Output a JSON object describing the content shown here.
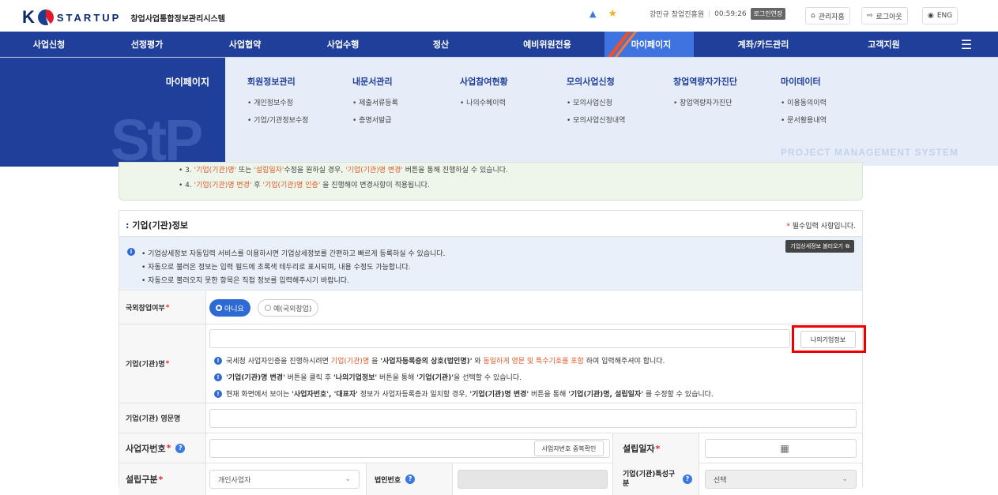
{
  "header": {
    "logo_k": "K",
    "logo_text": "STARTUP",
    "system_name": "창업사업통합정보관리시스템",
    "user_info": "강민규 창업진흥원",
    "timer": "00:59:26",
    "extend_label": "로그인연장",
    "admin_label": "관리자홈",
    "logout_label": "로그아웃",
    "lang_label": "ENG"
  },
  "nav": [
    "사업신청",
    "선정평가",
    "사업협약",
    "사업수행",
    "정산",
    "예비위원전용",
    "마이페이지",
    "계좌/카드관리",
    "고객지원"
  ],
  "mega": {
    "title": "마이페이지",
    "bg_text": "StP",
    "tagline": "PROJECT MANAGEMENT SYSTEM",
    "columns": [
      {
        "title": "회원정보관리",
        "items": [
          "개인정보수정",
          "기업/기관정보수정"
        ]
      },
      {
        "title": "내문서관리",
        "items": [
          "제출서류등록",
          "증명서발급"
        ]
      },
      {
        "title": "사업참여현황",
        "items": [
          "나의수혜이력"
        ]
      },
      {
        "title": "모의사업신청",
        "items": [
          "모의사업신청",
          "모의사업신청내역"
        ]
      },
      {
        "title": "창업역량자가진단",
        "items": [
          "창업역량자가진단"
        ]
      },
      {
        "title": "마이데이터",
        "items": [
          "이용동의이력",
          "문서활용내역"
        ]
      }
    ]
  },
  "notice": {
    "line3_a": "• 3. ",
    "line3_b": "'기업(기관)명'",
    "line3_c": " 또는 ",
    "line3_d": "'설립일자'",
    "line3_e": "수정을 원하실 경우, ",
    "line3_f": "'기업(기관)명 변경'",
    "line3_g": " 버튼을 통해 진행하실 수 있습니다.",
    "line4_a": "• 4. ",
    "line4_b": "'기업(기관)명 변경'",
    "line4_c": " 후 ",
    "line4_d": "'기업(기관)명 인증'",
    "line4_e": " 을 진행해야 변경사항이 적용됩니다."
  },
  "section": {
    "title": "기업(기관)정보",
    "required_note": "필수입력 사항입니다.",
    "load_button": "기업상세정보 불러오기",
    "info_lines": [
      "• 기업상세정보 자동입력 서비스를 이용하시면 기업상세정보를 간편하고 빠르게 등록하실 수 있습니다.",
      "• 자동으로 불러온 정보는 입력 필드에 초록색 테두리로 표시되며, 내용 수정도 가능합니다.",
      "• 자동으로 불러오지 못한 항목은 직접 정보를 입력해주시기 바랍니다."
    ]
  },
  "form": {
    "overseas_label": "국외창업여부",
    "overseas_no": "아니요",
    "overseas_yes": "예(국외창업)",
    "company_label": "기업(기관)명",
    "my_company_button": "나의기업정보",
    "note1_a": "국세청 사업자인증을 진행하시려면 ",
    "note1_b": "기업(기관)명",
    "note1_c": " 을 ",
    "note1_d": "'사업자등록증의 상호(법인명)'",
    "note1_e": " 와 ",
    "note1_f": "동일하게 영문 및 특수기호를 포함",
    "note1_g": " 하여 입력해주셔야 합니다.",
    "note2_a": "'기업(기관)명 변경'",
    "note2_b": " 버튼을 클릭 후 ",
    "note2_c": "'나의기업정보'",
    "note2_d": " 버튼을 통해 ",
    "note2_e": "'기업(기관)'",
    "note2_f": "을 선택할 수 있습니다.",
    "note3_a": "현재 화면에서 보이는 ",
    "note3_b": "'사업자번호', '대표자'",
    "note3_c": " 정보가 사업자등록증과 일치할 경우, ",
    "note3_d": "'기업(기관)명 변경'",
    "note3_e": " 버튼을 통해 ",
    "note3_f": "'기업(기관)명, 설립일자'",
    "note3_g": " 를 수정할 수 있습니다.",
    "english_label": "기업(기관) 영문명",
    "bizno_label": "사업자번호",
    "bizno_check_button": "사업자번호 중복확인",
    "founded_label": "설립일자",
    "type_label": "설립구분",
    "type_value": "개인사업자",
    "corpno_label": "법인번호",
    "feature_label": "기업(기관)특성구분",
    "feature_value": "선택"
  }
}
